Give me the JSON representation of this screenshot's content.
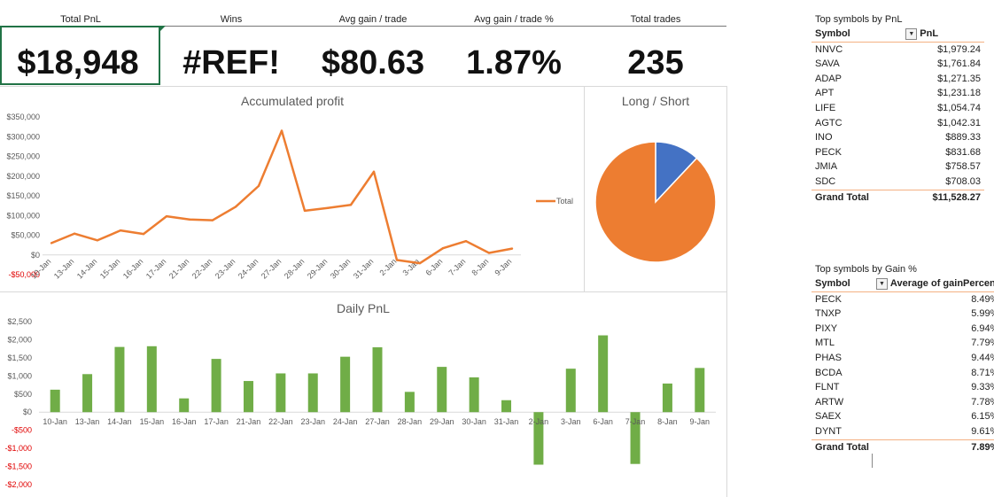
{
  "kpis": [
    {
      "label": "Total PnL",
      "value": "$18,948"
    },
    {
      "label": "Wins",
      "value": "#REF!"
    },
    {
      "label": "Avg gain / trade",
      "value": "$80.63"
    },
    {
      "label": "Avg gain / trade %",
      "value": "1.87%"
    },
    {
      "label": "Total trades",
      "value": "235"
    }
  ],
  "chart_data": [
    {
      "type": "line",
      "title": "Accumulated profit",
      "categories": [
        "10-Jan",
        "13-Jan",
        "14-Jan",
        "15-Jan",
        "16-Jan",
        "17-Jan",
        "21-Jan",
        "22-Jan",
        "23-Jan",
        "24-Jan",
        "27-Jan",
        "28-Jan",
        "29-Jan",
        "30-Jan",
        "31-Jan",
        "2-Jan",
        "3-Jan",
        "6-Jan",
        "7-Jan",
        "8-Jan",
        "9-Jan"
      ],
      "series": [
        {
          "name": "Total",
          "values": [
            30000,
            54000,
            37000,
            62000,
            53000,
            98000,
            90000,
            88000,
            122000,
            175000,
            315000,
            112000,
            119000,
            127000,
            211000,
            -13000,
            -21000,
            17000,
            35000,
            5000,
            16000
          ]
        }
      ],
      "ylim": [
        -50000,
        350000
      ],
      "y_ticks": [
        "$350,000",
        "$300,000",
        "$250,000",
        "$200,000",
        "$150,000",
        "$100,000",
        "$50,000",
        "$0",
        "-$50,000"
      ],
      "legend": "right",
      "color": "#ed7d31"
    },
    {
      "type": "pie",
      "title": "Long / Short",
      "slices": [
        {
          "value": 12,
          "color": "#4472c4"
        },
        {
          "value": 88,
          "color": "#ed7d31"
        }
      ]
    },
    {
      "type": "bar",
      "title": "Daily PnL",
      "categories": [
        "10-Jan",
        "13-Jan",
        "14-Jan",
        "15-Jan",
        "16-Jan",
        "17-Jan",
        "21-Jan",
        "22-Jan",
        "23-Jan",
        "24-Jan",
        "27-Jan",
        "28-Jan",
        "29-Jan",
        "30-Jan",
        "31-Jan",
        "2-Jan",
        "3-Jan",
        "6-Jan",
        "7-Jan",
        "8-Jan",
        "9-Jan"
      ],
      "values": [
        620,
        1050,
        1800,
        1820,
        380,
        1470,
        860,
        1070,
        1070,
        1530,
        1790,
        560,
        1250,
        960,
        330,
        -1450,
        1200,
        2120,
        -1430,
        790,
        1220
      ],
      "ylim": [
        -2000,
        2500
      ],
      "y_ticks": [
        "$2,500",
        "$2,000",
        "$1,500",
        "$1,000",
        "$500",
        "$0",
        "-$500",
        "-$1,000",
        "-$1,500",
        "-$2,000"
      ],
      "color": "#70ad47"
    }
  ],
  "pivot_pnl": {
    "title": "Top symbols by PnL",
    "col1": "Symbol",
    "col2": "PnL",
    "rows": [
      {
        "symbol": "NNVC",
        "value": "$1,979.24"
      },
      {
        "symbol": "SAVA",
        "value": "$1,761.84"
      },
      {
        "symbol": "ADAP",
        "value": "$1,271.35"
      },
      {
        "symbol": "APT",
        "value": "$1,231.18"
      },
      {
        "symbol": "LIFE",
        "value": "$1,054.74"
      },
      {
        "symbol": "AGTC",
        "value": "$1,042.31"
      },
      {
        "symbol": "INO",
        "value": "$889.33"
      },
      {
        "symbol": "PECK",
        "value": "$831.68"
      },
      {
        "symbol": "JMIA",
        "value": "$758.57"
      },
      {
        "symbol": "SDC",
        "value": "$708.03"
      }
    ],
    "total_label": "Grand Total",
    "total_value": "$11,528.27"
  },
  "pivot_gain": {
    "title": "Top symbols by Gain %",
    "col1": "Symbol",
    "col2": "Average of gainPercent",
    "rows": [
      {
        "symbol": "PECK",
        "value": "8.49%"
      },
      {
        "symbol": "TNXP",
        "value": "5.99%"
      },
      {
        "symbol": "PIXY",
        "value": "6.94%"
      },
      {
        "symbol": "MTL",
        "value": "7.79%"
      },
      {
        "symbol": "PHAS",
        "value": "9.44%"
      },
      {
        "symbol": "BCDA",
        "value": "8.71%"
      },
      {
        "symbol": "FLNT",
        "value": "9.33%"
      },
      {
        "symbol": "ARTW",
        "value": "7.78%"
      },
      {
        "symbol": "SAEX",
        "value": "6.15%"
      },
      {
        "symbol": "DYNT",
        "value": "9.61%"
      }
    ],
    "total_label": "Grand Total",
    "total_value": "7.89%"
  },
  "filter_icon": "filter-dropdown-icon"
}
